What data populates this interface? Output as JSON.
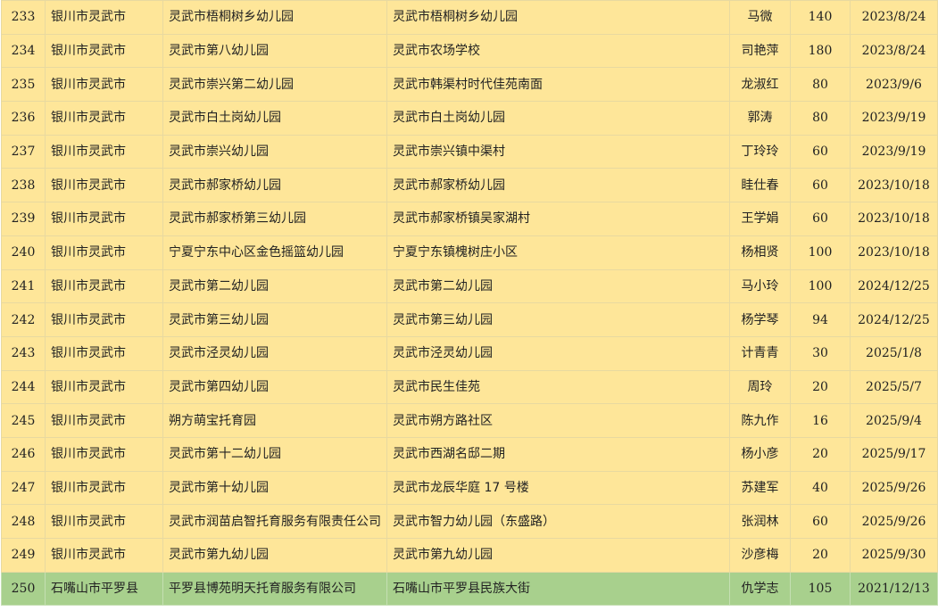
{
  "rows": [
    {
      "no": "233",
      "city": "银川市灵武市",
      "name": "灵武市梧桐树乡幼儿园",
      "addr": "灵武市梧桐树乡幼儿园",
      "person": "马微",
      "cap": "140",
      "date": "2023/8/24",
      "color": "yellow"
    },
    {
      "no": "234",
      "city": "银川市灵武市",
      "name": "灵武市第八幼儿园",
      "addr": "灵武市农场学校",
      "person": "司艳萍",
      "cap": "180",
      "date": "2023/8/24",
      "color": "yellow"
    },
    {
      "no": "235",
      "city": "银川市灵武市",
      "name": "灵武市崇兴第二幼儿园",
      "addr": "灵武市韩渠村时代佳苑南面",
      "person": "龙淑红",
      "cap": "80",
      "date": "2023/9/6",
      "color": "yellow"
    },
    {
      "no": "236",
      "city": "银川市灵武市",
      "name": "灵武市白土岗幼儿园",
      "addr": "灵武市白土岗幼儿园",
      "person": "郭涛",
      "cap": "80",
      "date": "2023/9/19",
      "color": "yellow"
    },
    {
      "no": "237",
      "city": "银川市灵武市",
      "name": "灵武市崇兴幼儿园",
      "addr": "灵武市崇兴镇中渠村",
      "person": "丁玲玲",
      "cap": "60",
      "date": "2023/9/19",
      "color": "yellow"
    },
    {
      "no": "238",
      "city": "银川市灵武市",
      "name": "灵武市郝家桥幼儿园",
      "addr": "灵武市郝家桥幼儿园",
      "person": "眭仕春",
      "cap": "60",
      "date": "2023/10/18",
      "color": "yellow"
    },
    {
      "no": "239",
      "city": "银川市灵武市",
      "name": "灵武市郝家桥第三幼儿园",
      "addr": "灵武市郝家桥镇吴家湖村",
      "person": "王学娟",
      "cap": "60",
      "date": "2023/10/18",
      "color": "yellow"
    },
    {
      "no": "240",
      "city": "银川市灵武市",
      "name": "宁夏宁东中心区金色摇篮幼儿园",
      "addr": "宁夏宁东镇槐树庄小区",
      "person": "杨相贤",
      "cap": "100",
      "date": "2023/10/18",
      "color": "yellow"
    },
    {
      "no": "241",
      "city": "银川市灵武市",
      "name": "灵武市第二幼儿园",
      "addr": "灵武市第二幼儿园",
      "person": "马小玲",
      "cap": "100",
      "date": "2024/12/25",
      "color": "yellow"
    },
    {
      "no": "242",
      "city": "银川市灵武市",
      "name": "灵武市第三幼儿园",
      "addr": "灵武市第三幼儿园",
      "person": "杨学琴",
      "cap": "94",
      "date": "2024/12/25",
      "color": "yellow"
    },
    {
      "no": "243",
      "city": "银川市灵武市",
      "name": "灵武市泾灵幼儿园",
      "addr": "灵武市泾灵幼儿园",
      "person": "计青青",
      "cap": "30",
      "date": "2025/1/8",
      "color": "yellow"
    },
    {
      "no": "244",
      "city": "银川市灵武市",
      "name": "灵武市第四幼儿园",
      "addr": "灵武市民生佳苑",
      "person": "周玲",
      "cap": "20",
      "date": "2025/5/7",
      "color": "yellow"
    },
    {
      "no": "245",
      "city": "银川市灵武市",
      "name": "朔方萌宝托育园",
      "addr": "灵武市朔方路社区",
      "person": "陈九作",
      "cap": "16",
      "date": "2025/9/4",
      "color": "yellow"
    },
    {
      "no": "246",
      "city": "银川市灵武市",
      "name": "灵武市第十二幼儿园",
      "addr": "灵武市西湖名邸二期",
      "person": "杨小彦",
      "cap": "20",
      "date": "2025/9/17",
      "color": "yellow"
    },
    {
      "no": "247",
      "city": "银川市灵武市",
      "name": "灵武市第十幼儿园",
      "addr": "灵武市龙辰华庭 17 号楼",
      "person": "苏建军",
      "cap": "40",
      "date": "2025/9/26",
      "color": "yellow"
    },
    {
      "no": "248",
      "city": "银川市灵武市",
      "name": "灵武市润苗启智托育服务有限责任公司",
      "addr": "灵武市智力幼儿园（东盛路）",
      "person": "张润林",
      "cap": "60",
      "date": "2025/9/26",
      "color": "yellow"
    },
    {
      "no": "249",
      "city": "银川市灵武市",
      "name": "灵武市第九幼儿园",
      "addr": "灵武市第九幼儿园",
      "person": "沙彦梅",
      "cap": "20",
      "date": "2025/9/30",
      "color": "yellow"
    },
    {
      "no": "250",
      "city": "石嘴山市平罗县",
      "name": "平罗县博苑明天托育服务有限公司",
      "addr": "石嘴山市平罗县民族大街",
      "person": "仇学志",
      "cap": "105",
      "date": "2021/12/13",
      "color": "green"
    }
  ]
}
